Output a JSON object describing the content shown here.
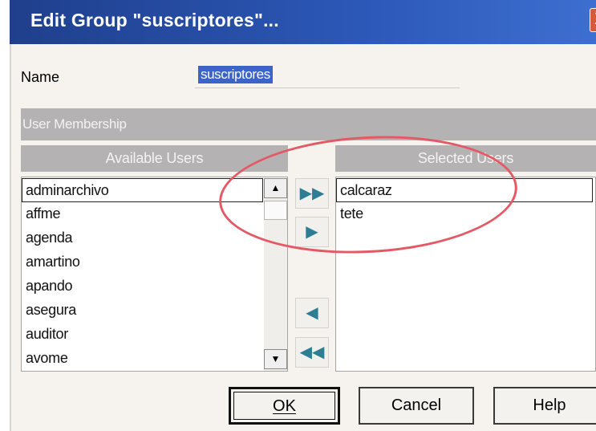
{
  "window": {
    "title": "Edit Group \"suscriptores\"...",
    "close_glyph": "X"
  },
  "form": {
    "name_label": "Name",
    "name_value": "suscriptores"
  },
  "membership": {
    "group_label": "User Membership",
    "available_header": "Available Users",
    "selected_header": "Selected Users",
    "available_users": [
      "adminarchivo",
      "affme",
      "agenda",
      "amartino",
      "apando",
      "asegura",
      "auditor",
      "avome"
    ],
    "selected_users": [
      "calcaraz",
      "tete"
    ]
  },
  "move_buttons": {
    "add_all": "▶▶",
    "add": "▶",
    "remove": "◀",
    "remove_all": "◀◀"
  },
  "buttons": {
    "ok": "OK",
    "cancel": "Cancel",
    "help": "Help"
  },
  "icons": {
    "scroll_up": "▲",
    "scroll_down": "▼"
  },
  "colors": {
    "titlebar": "#2c58b8",
    "highlight": "#3b64c8",
    "arrows": "#2d7e94",
    "annotation": "#e35a66"
  }
}
